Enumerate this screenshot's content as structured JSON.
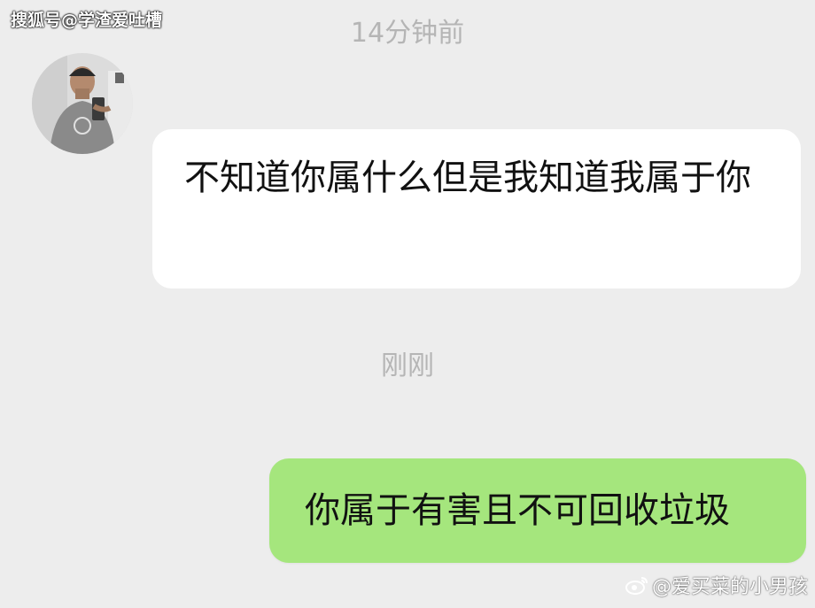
{
  "watermark_top": "搜狐号@学渣爱吐槽",
  "timestamps": [
    "14分钟前",
    "刚刚"
  ],
  "messages": [
    {
      "side": "left",
      "text": "不知道你属什么但是我知道我属于你"
    },
    {
      "side": "right",
      "text": "你属于有害且不可回收垃圾"
    }
  ],
  "watermark_bottom": "@爱买菜的小男孩",
  "colors": {
    "background": "#ededed",
    "bubble_left": "#ffffff",
    "bubble_right": "#a5e67d",
    "timestamp": "#b5b5b5"
  },
  "icons": [
    "avatar-photo",
    "weibo-logo-icon"
  ]
}
